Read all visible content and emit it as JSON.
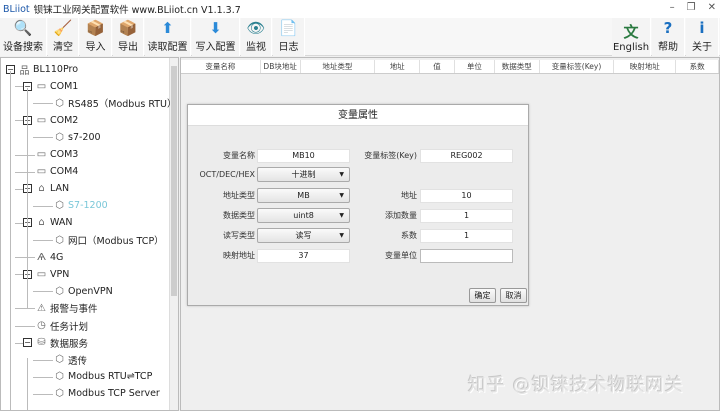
{
  "window": {
    "brand": "BLiiot",
    "title": "钡铼工业网关配置软件 www.BLiiot.cn V1.1.3.7",
    "minimize": "–",
    "restore": "❐",
    "close": "✕"
  },
  "toolbar": [
    {
      "label": "设备搜索",
      "icon": "search-icon",
      "glyph": "🔍"
    },
    {
      "label": "清空",
      "icon": "brush-icon",
      "glyph": "🧹"
    },
    {
      "label": "导入",
      "icon": "import-box-icon",
      "glyph": "📦"
    },
    {
      "label": "导出",
      "icon": "export-box-icon",
      "glyph": "📦"
    },
    {
      "label": "读取配置",
      "icon": "upload-icon",
      "glyph": "⬆"
    },
    {
      "label": "写入配置",
      "icon": "download-icon",
      "glyph": "⬇"
    },
    {
      "label": "监视",
      "icon": "eye-icon",
      "glyph": "👁"
    },
    {
      "label": "日志",
      "icon": "log-file-icon",
      "glyph": "📄"
    }
  ],
  "toolbar_right": [
    {
      "label": "English",
      "icon": "language-icon",
      "glyph": "文"
    },
    {
      "label": "帮助",
      "icon": "help-icon",
      "glyph": "?"
    },
    {
      "label": "关于",
      "icon": "info-icon",
      "glyph": "i"
    }
  ],
  "tree": [
    {
      "label": "BL110Pro",
      "level": 0,
      "expander": "−",
      "icon": "network-icon",
      "glyph": "品"
    },
    {
      "label": "COM1",
      "level": 1,
      "expander": "−",
      "icon": "serial-port-icon",
      "glyph": "▭"
    },
    {
      "label": "RS485（Modbus RTU）",
      "level": 2,
      "icon": "device-cube-icon",
      "glyph": "⬡"
    },
    {
      "label": "COM2",
      "level": 1,
      "expander": "−",
      "icon": "serial-port-icon",
      "glyph": "▭"
    },
    {
      "label": "s7-200",
      "level": 2,
      "icon": "device-cube-icon",
      "glyph": "⬡"
    },
    {
      "label": "COM3",
      "level": 1,
      "icon": "serial-port-icon",
      "glyph": "▭"
    },
    {
      "label": "COM4",
      "level": 1,
      "icon": "serial-port-icon",
      "glyph": "▭"
    },
    {
      "label": "LAN",
      "level": 1,
      "expander": "−",
      "icon": "ethernet-icon",
      "glyph": "⌂"
    },
    {
      "label": "S7-1200",
      "level": 2,
      "icon": "device-cube-icon",
      "glyph": "⬡",
      "selected": true
    },
    {
      "label": "WAN",
      "level": 1,
      "expander": "−",
      "icon": "ethernet-icon",
      "glyph": "⌂"
    },
    {
      "label": "网口（Modbus TCP）",
      "level": 2,
      "icon": "device-cube-icon",
      "glyph": "⬡"
    },
    {
      "label": "4G",
      "level": 1,
      "icon": "antenna-icon",
      "glyph": "Ѧ"
    },
    {
      "label": "VPN",
      "level": 1,
      "expander": "−",
      "icon": "vpn-icon",
      "glyph": "▭"
    },
    {
      "label": "OpenVPN",
      "level": 2,
      "icon": "device-cube-icon",
      "glyph": "⬡"
    },
    {
      "label": "报警与事件",
      "level": 1,
      "icon": "alarm-icon",
      "glyph": "⚠"
    },
    {
      "label": "任务计划",
      "level": 1,
      "icon": "schedule-icon",
      "glyph": "◷"
    },
    {
      "label": "数据服务",
      "level": 1,
      "expander": "−",
      "icon": "database-icon",
      "glyph": "⛁"
    },
    {
      "label": "透传",
      "level": 2,
      "icon": "device-cube-icon",
      "glyph": "⬡"
    },
    {
      "label": "Modbus RTU⇌TCP",
      "level": 2,
      "icon": "device-cube-icon",
      "glyph": "⬡"
    },
    {
      "label": "Modbus TCP Server",
      "level": 2,
      "icon": "device-cube-icon",
      "glyph": "⬡"
    }
  ],
  "table": {
    "columns": [
      "变量名称",
      "DB块地址",
      "地址类型",
      "地址",
      "值",
      "单位",
      "数据类型",
      "变量标签(Key)",
      "映射地址",
      "系数"
    ]
  },
  "dialog": {
    "title": "变量属性",
    "var_name_label": "变量名称",
    "var_name": "MB10",
    "key_label": "变量标签(Key)",
    "key": "REG002",
    "radix_label": "OCT/DEC/HEX",
    "radix": "十进制",
    "addr_type_label": "地址类型",
    "addr_type": "MB",
    "addr_label": "地址",
    "addr": "10",
    "data_type_label": "数据类型",
    "data_type": "uint8",
    "add_count_label": "添加数量",
    "add_count": "1",
    "rw_label": "读写类型",
    "rw": "读写",
    "coef_label": "系数",
    "coef": "1",
    "map_addr_label": "映射地址",
    "map_addr": "37",
    "unit_label": "变量单位",
    "unit": "",
    "ok": "确定",
    "cancel": "取消"
  },
  "watermark": "知乎 @钡铼技术物联网关"
}
